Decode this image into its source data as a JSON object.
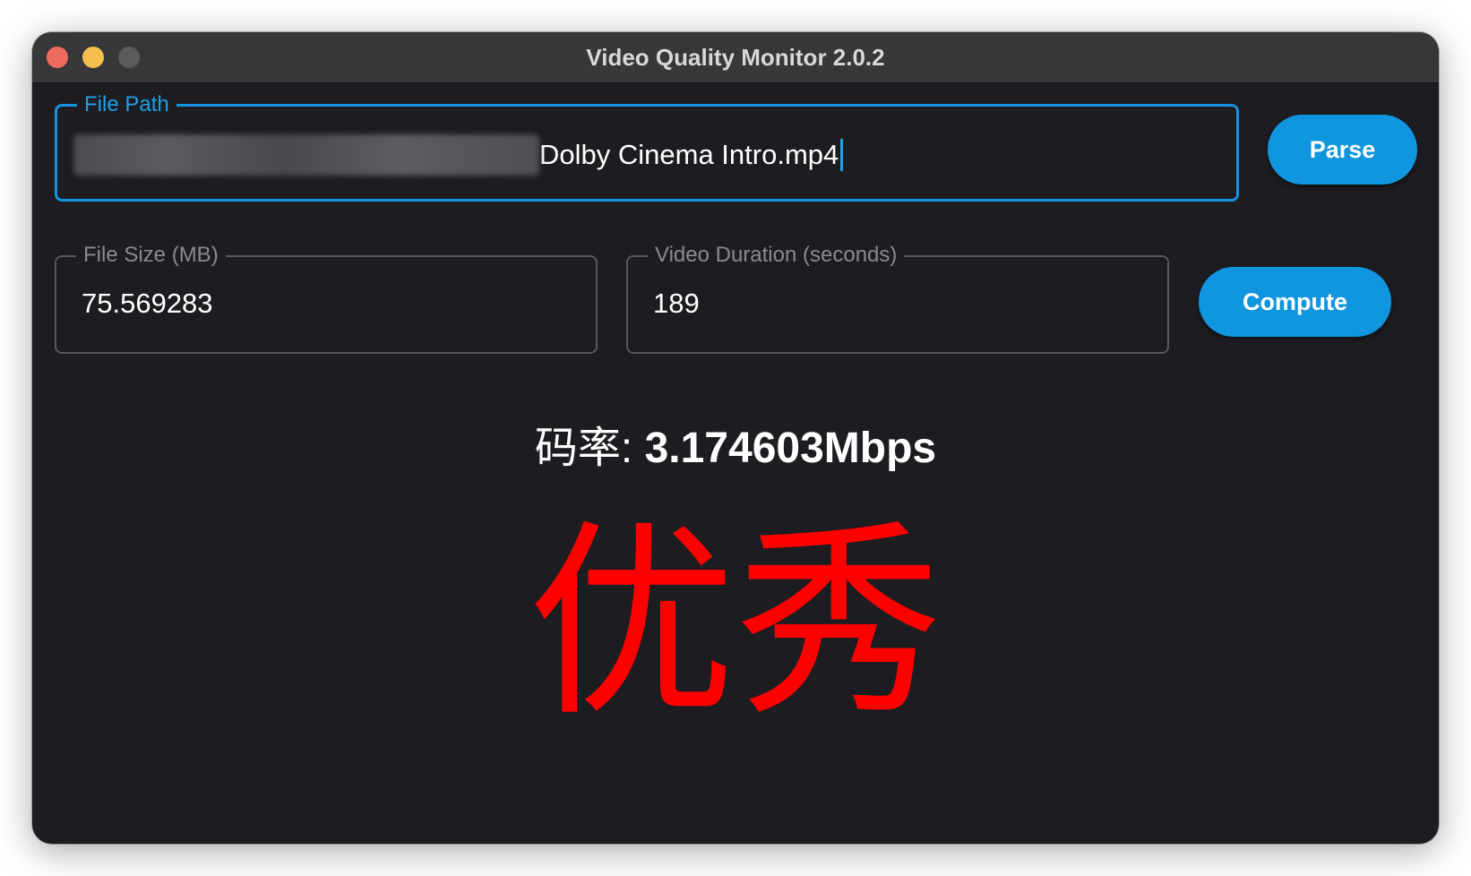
{
  "window": {
    "title": "Video Quality Monitor 2.0.2"
  },
  "path_field": {
    "legend": "File Path",
    "value_visible": "Dolby Cinema Intro.mp4"
  },
  "size_field": {
    "legend": "File Size (MB)",
    "value": "75.569283"
  },
  "duration_field": {
    "legend": "Video Duration (seconds)",
    "value": "189"
  },
  "buttons": {
    "parse": "Parse",
    "compute": "Compute"
  },
  "result": {
    "bitrate_label": "码率: ",
    "bitrate_value": "3.174603Mbps",
    "rating": "优秀"
  },
  "colors": {
    "accent": "#0f96df",
    "rating": "#ff0000",
    "background": "#1d1d21"
  }
}
